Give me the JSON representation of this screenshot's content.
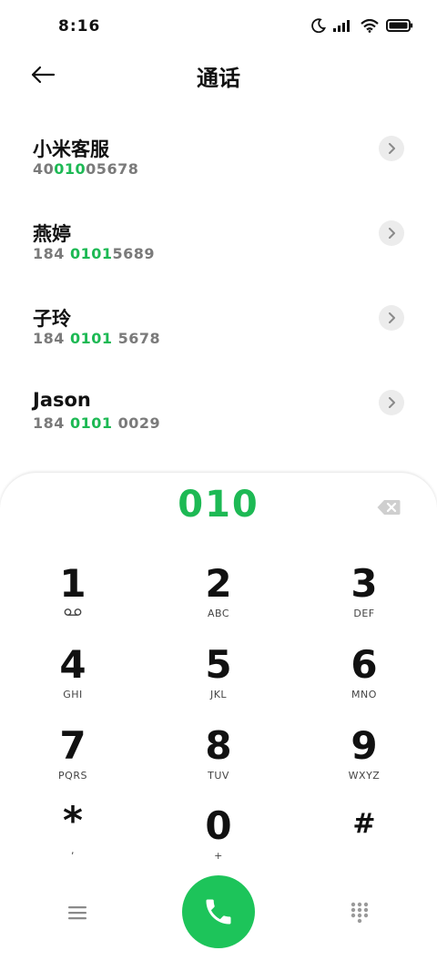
{
  "status_bar": {
    "time": "8:16",
    "icons": [
      "moon-icon",
      "signal-icon",
      "wifi-icon",
      "battery-icon"
    ]
  },
  "header": {
    "title": "通话",
    "back_icon": "arrow-left-icon"
  },
  "contacts": [
    {
      "name": "小米客服",
      "number_pre": "40",
      "number_match": "010",
      "number_post": "05678"
    },
    {
      "name": "燕婷",
      "number_pre": "184 ",
      "number_match": "0101",
      "number_post": "5689"
    },
    {
      "name": "子玲",
      "number_pre": "184 ",
      "number_match": "0101",
      "number_post": " 5678"
    },
    {
      "name": "Jason",
      "number_pre": "184 ",
      "number_match": "0101",
      "number_post": " 0029"
    }
  ],
  "dialpad": {
    "dialed": "010",
    "keys": [
      {
        "digit": "1",
        "letters": ""
      },
      {
        "digit": "2",
        "letters": "ABC"
      },
      {
        "digit": "3",
        "letters": "DEF"
      },
      {
        "digit": "4",
        "letters": "GHI"
      },
      {
        "digit": "5",
        "letters": "JKL"
      },
      {
        "digit": "6",
        "letters": "MNO"
      },
      {
        "digit": "7",
        "letters": "PQRS"
      },
      {
        "digit": "8",
        "letters": "TUV"
      },
      {
        "digit": "9",
        "letters": "WXYZ"
      },
      {
        "digit": "*",
        "letters": ","
      },
      {
        "digit": "0",
        "letters": "+"
      },
      {
        "digit": "#",
        "letters": ""
      }
    ]
  },
  "colors": {
    "accent": "#1db954",
    "call_button": "#1dc45a",
    "muted_text": "#7a7a7a"
  }
}
